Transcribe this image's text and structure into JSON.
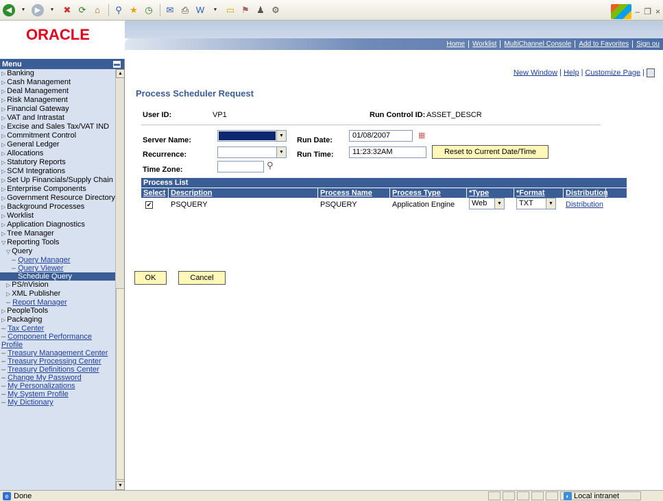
{
  "browser": {
    "status": "Done",
    "zone": "Local intranet"
  },
  "brand": {
    "logo": "ORACLE"
  },
  "topnav": [
    "Home",
    "Worklist",
    "MultiChannel Console",
    "Add to Favorites",
    "Sign ou"
  ],
  "menu": {
    "title": "Menu",
    "items": [
      {
        "label": "Banking",
        "type": "folder",
        "level": 0
      },
      {
        "label": "Cash Management",
        "type": "folder",
        "level": 0
      },
      {
        "label": "Deal Management",
        "type": "folder",
        "level": 0
      },
      {
        "label": "Risk Management",
        "type": "folder",
        "level": 0
      },
      {
        "label": "Financial Gateway",
        "type": "folder",
        "level": 0
      },
      {
        "label": "VAT and Intrastat",
        "type": "folder",
        "level": 0
      },
      {
        "label": "Excise and Sales Tax/VAT IND",
        "type": "folder",
        "level": 0
      },
      {
        "label": "Commitment Control",
        "type": "folder",
        "level": 0
      },
      {
        "label": "General Ledger",
        "type": "folder",
        "level": 0
      },
      {
        "label": "Allocations",
        "type": "folder",
        "level": 0
      },
      {
        "label": "Statutory Reports",
        "type": "folder",
        "level": 0
      },
      {
        "label": "SCM Integrations",
        "type": "folder",
        "level": 0
      },
      {
        "label": "Set Up Financials/Supply Chain",
        "type": "folder",
        "level": 0
      },
      {
        "label": "Enterprise Components",
        "type": "folder",
        "level": 0
      },
      {
        "label": "Government Resource Directory",
        "type": "folder",
        "level": 0
      },
      {
        "label": "Background Processes",
        "type": "folder",
        "level": 0
      },
      {
        "label": "Worklist",
        "type": "folder",
        "level": 0
      },
      {
        "label": "Application Diagnostics",
        "type": "folder",
        "level": 0
      },
      {
        "label": "Tree Manager",
        "type": "folder",
        "level": 0
      },
      {
        "label": "Reporting Tools",
        "type": "open",
        "level": 0
      },
      {
        "label": "Query",
        "type": "open",
        "level": 1
      },
      {
        "label": "Query Manager",
        "type": "link",
        "level": 2
      },
      {
        "label": "Query Viewer",
        "type": "link",
        "level": 2
      },
      {
        "label": "Schedule Query",
        "type": "selected",
        "level": 2
      },
      {
        "label": "PS/nVision",
        "type": "folder",
        "level": 1
      },
      {
        "label": "XML Publisher",
        "type": "folder",
        "level": 1
      },
      {
        "label": "Report Manager",
        "type": "link",
        "level": 1
      },
      {
        "label": "PeopleTools",
        "type": "folder",
        "level": 0
      },
      {
        "label": "Packaging",
        "type": "folder",
        "level": 0
      },
      {
        "label": "Tax Center",
        "type": "link",
        "level": 0
      },
      {
        "label": "Component Performance Profile",
        "type": "link",
        "level": 0
      },
      {
        "label": "Treasury Management Center",
        "type": "link",
        "level": 0
      },
      {
        "label": "Treasury Processing Center",
        "type": "link",
        "level": 0
      },
      {
        "label": "Treasury Definitions Center",
        "type": "link",
        "level": 0
      },
      {
        "label": "Change My Password",
        "type": "link",
        "level": 0
      },
      {
        "label": "My Personalizations",
        "type": "link",
        "level": 0
      },
      {
        "label": "My System Profile",
        "type": "link",
        "level": 0
      },
      {
        "label": "My Dictionary",
        "type": "link",
        "level": 0
      }
    ]
  },
  "page": {
    "links": {
      "new_window": "New Window",
      "help": "Help",
      "customize": "Customize Page",
      "sep": "|"
    },
    "title": "Process Scheduler Request",
    "user_id_label": "User ID:",
    "user_id": "VP1",
    "run_control_label": "Run Control ID:",
    "run_control": "ASSET_DESCR",
    "server_label": "Server Name:",
    "recurrence_label": "Recurrence:",
    "timezone_label": "Time Zone:",
    "run_date_label": "Run Date:",
    "run_date": "01/08/2007",
    "run_time_label": "Run Time:",
    "run_time": "11:23:32AM",
    "reset_button": "Reset to Current Date/Time",
    "ok_button": "OK",
    "cancel_button": "Cancel"
  },
  "process_list": {
    "caption": "Process List",
    "columns": [
      "Select",
      "Description",
      "Process Name",
      "Process Type",
      "*Type",
      "*Format",
      "Distribution"
    ],
    "rows": [
      {
        "selected": true,
        "description": "PSQUERY",
        "process_name": "PSQUERY",
        "process_type": "Application Engine",
        "type": "Web",
        "format": "TXT",
        "distribution": "Distribution"
      }
    ]
  },
  "colors": {
    "menu_bg": "#d8e1ef",
    "accent": "#3a5d96",
    "link": "#1f3f9a",
    "button": "#fff8b8",
    "logo": "#e4001b"
  }
}
